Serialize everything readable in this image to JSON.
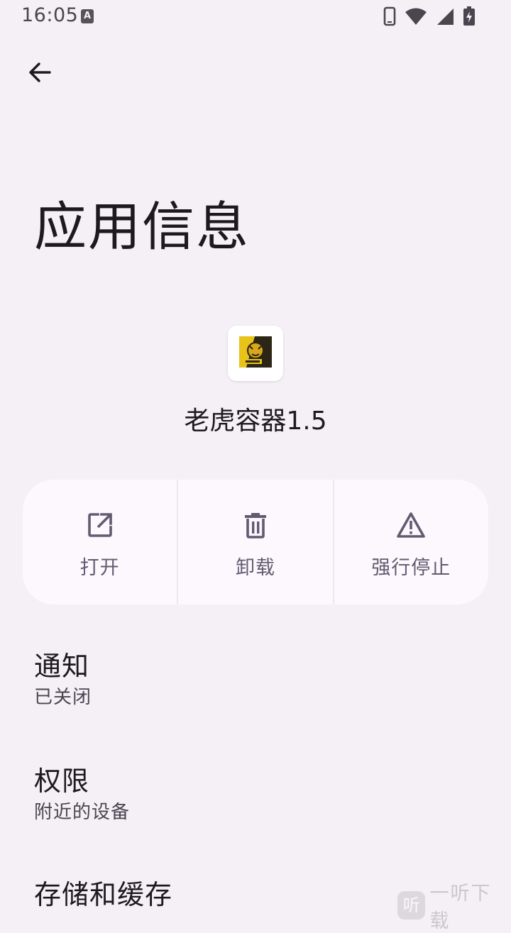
{
  "status_bar": {
    "time": "16:05",
    "keyboard_badge": "A",
    "icons": [
      "phone-icon",
      "wifi-icon",
      "signal-icon",
      "battery-charging-icon"
    ]
  },
  "header": {
    "back_icon": "arrow-left-icon",
    "title": "应用信息"
  },
  "app": {
    "name": "老虎容器1.5",
    "icon": "tiger-app-icon"
  },
  "actions": [
    {
      "label": "打开",
      "icon": "open-external-icon"
    },
    {
      "label": "卸载",
      "icon": "trash-icon"
    },
    {
      "label": "强行停止",
      "icon": "warning-icon"
    }
  ],
  "settings": [
    {
      "title": "通知",
      "subtitle": "已关闭"
    },
    {
      "title": "权限",
      "subtitle": "附近的设备"
    },
    {
      "title": "存储和缓存",
      "subtitle": ""
    }
  ],
  "watermark": {
    "badge": "听",
    "text": "一听下载"
  },
  "colors": {
    "background": "#f4f0f6",
    "card": "#fcf8fd",
    "accent": "#625b71",
    "text_primary": "#1c1a20",
    "text_secondary": "#4a4650"
  }
}
